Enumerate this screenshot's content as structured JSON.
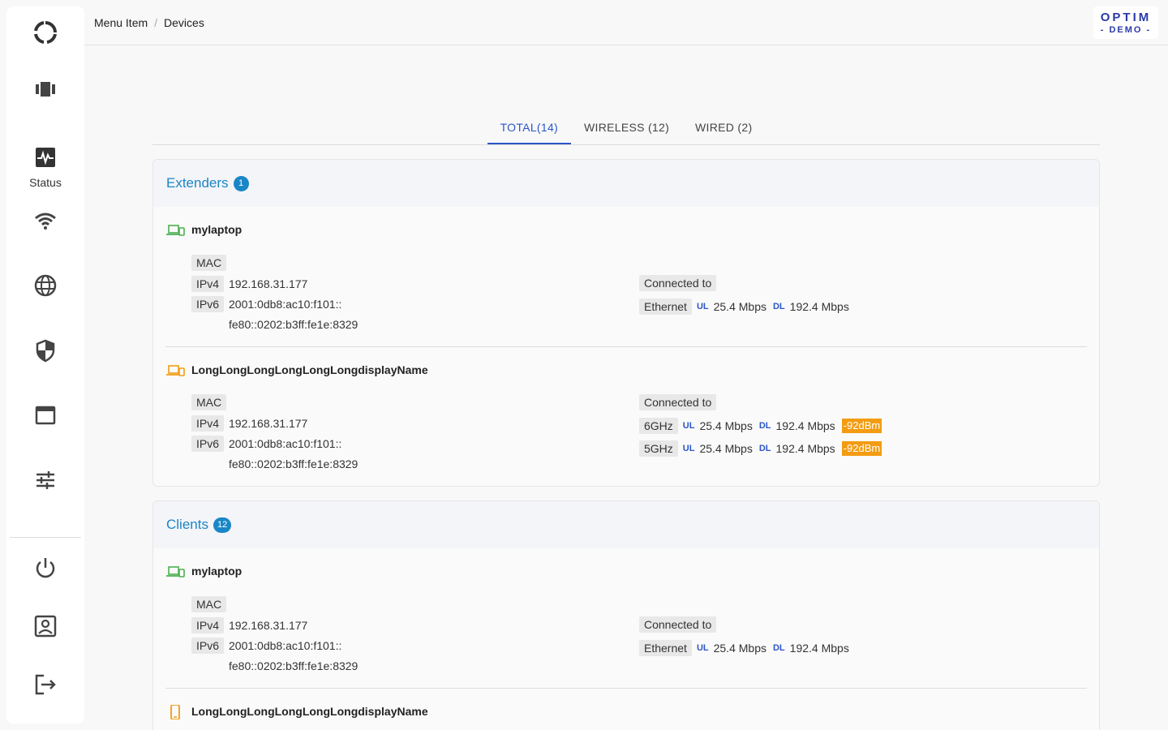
{
  "breadcrumb": {
    "root": "Menu Item",
    "separator": "/",
    "current": "Devices"
  },
  "logo": {
    "line1": "OPTIM",
    "line2": "- DEMO -"
  },
  "sidebar": {
    "status_label": "Status"
  },
  "tabs": [
    {
      "label": "TOTAL(14)",
      "active": true
    },
    {
      "label": "WIRELESS (12)",
      "active": false
    },
    {
      "label": "WIRED (2)",
      "active": false
    }
  ],
  "extenders": {
    "title": "Extenders",
    "count": "1",
    "devices": [
      {
        "name": "mylaptop",
        "mac_label": "MAC",
        "ipv4_label": "IPv4",
        "ipv4": "192.168.31.177",
        "ipv6_label": "IPv6",
        "ipv6_1": "2001:0db8:ac10:f101::",
        "ipv6_2": "fe80::0202:b3ff:fe1e:8329",
        "connected_label": "Connected to",
        "links": [
          {
            "type": "Ethernet",
            "ul_label": "UL",
            "ul": "25.4 Mbps",
            "dl_label": "DL",
            "dl": "192.4 Mbps"
          }
        ]
      },
      {
        "name": "LongLongLongLongLongLongdisplayName",
        "mac_label": "MAC",
        "ipv4_label": "IPv4",
        "ipv4": "192.168.31.177",
        "ipv6_label": "IPv6",
        "ipv6_1": "2001:0db8:ac10:f101::",
        "ipv6_2": "fe80::0202:b3ff:fe1e:8329",
        "connected_label": "Connected to",
        "links": [
          {
            "type": "6GHz",
            "ul_label": "UL",
            "ul": "25.4 Mbps",
            "dl_label": "DL",
            "dl": "192.4 Mbps",
            "rssi": "-92dBm"
          },
          {
            "type": "5GHz",
            "ul_label": "UL",
            "ul": "25.4 Mbps",
            "dl_label": "DL",
            "dl": "192.4 Mbps",
            "rssi": "-92dBm"
          }
        ]
      }
    ]
  },
  "clients": {
    "title": "Clients",
    "count": "12",
    "devices": [
      {
        "name": "mylaptop",
        "mac_label": "MAC",
        "ipv4_label": "IPv4",
        "ipv4": "192.168.31.177",
        "ipv6_label": "IPv6",
        "ipv6_1": "2001:0db8:ac10:f101::",
        "ipv6_2": "fe80::0202:b3ff:fe1e:8329",
        "connected_label": "Connected to",
        "links": [
          {
            "type": "Ethernet",
            "ul_label": "UL",
            "ul": "25.4 Mbps",
            "dl_label": "DL",
            "dl": "192.4 Mbps"
          }
        ]
      },
      {
        "name": "LongLongLongLongLongLongdisplayName"
      }
    ]
  },
  "colors": {
    "accent": "#2b56c9",
    "section_title": "#1a86c7",
    "rssi_warn": "#f39c12",
    "wired_icon": "#4caf50",
    "wireless_icon": "#f39c12"
  }
}
